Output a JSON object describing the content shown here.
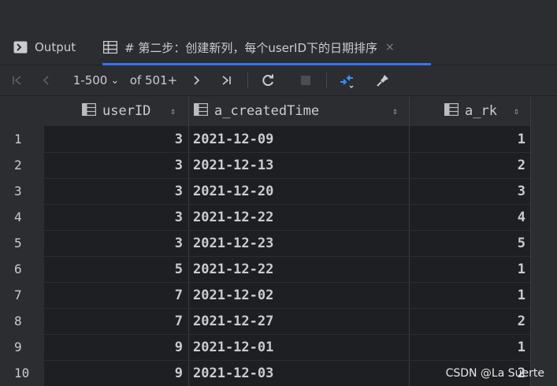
{
  "tabs": {
    "output_label": "Output",
    "active_label": "# 第二步：创建新列，每个userID下的日期排序",
    "close_glyph": "×"
  },
  "toolbar": {
    "first_glyph": "|<",
    "prev_glyph": "<",
    "page_range": "1-500",
    "page_range_caret": "⌄",
    "total": "of 501+",
    "next_glyph": ">",
    "last_glyph": ">|"
  },
  "columns": [
    {
      "label": "userID"
    },
    {
      "label": "a_createdTime"
    },
    {
      "label": "a_rk"
    }
  ],
  "rows": [
    {
      "n": "1",
      "userID": "3",
      "a_createdTime": "2021-12-09",
      "a_rk": "1"
    },
    {
      "n": "2",
      "userID": "3",
      "a_createdTime": "2021-12-13",
      "a_rk": "2"
    },
    {
      "n": "3",
      "userID": "3",
      "a_createdTime": "2021-12-20",
      "a_rk": "3"
    },
    {
      "n": "4",
      "userID": "3",
      "a_createdTime": "2021-12-22",
      "a_rk": "4"
    },
    {
      "n": "5",
      "userID": "3",
      "a_createdTime": "2021-12-23",
      "a_rk": "5"
    },
    {
      "n": "6",
      "userID": "5",
      "a_createdTime": "2021-12-22",
      "a_rk": "1"
    },
    {
      "n": "7",
      "userID": "7",
      "a_createdTime": "2021-12-02",
      "a_rk": "1"
    },
    {
      "n": "8",
      "userID": "7",
      "a_createdTime": "2021-12-27",
      "a_rk": "2"
    },
    {
      "n": "9",
      "userID": "9",
      "a_createdTime": "2021-12-01",
      "a_rk": "1"
    },
    {
      "n": "10",
      "userID": "9",
      "a_createdTime": "2021-12-03",
      "a_rk": "2"
    }
  ],
  "watermark": "CSDN @La Suerte",
  "colors": {
    "accent": "#3574f0",
    "refresh_icon": "#c9ccd1",
    "compare_icon": "#3d8bff"
  }
}
